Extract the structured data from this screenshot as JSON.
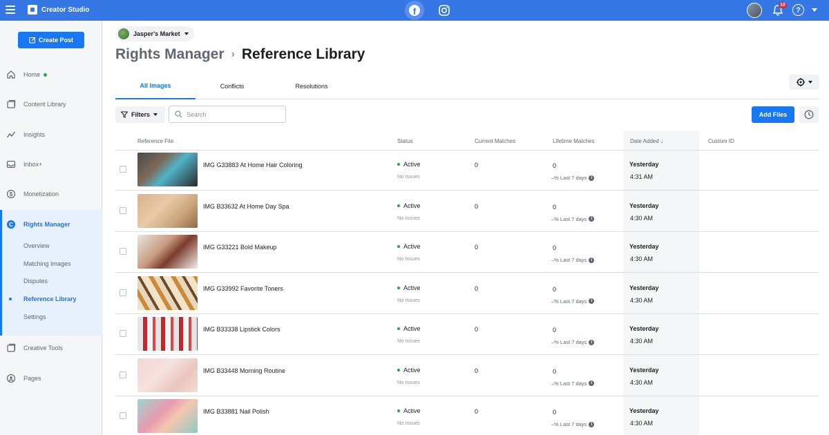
{
  "app": {
    "name": "Creator Studio"
  },
  "topbar": {
    "notification_count": "10",
    "help_label": "?"
  },
  "sidebar": {
    "create_label": "Create Post",
    "items": [
      {
        "label": "Home",
        "icon": "home-icon"
      },
      {
        "label": "Content Library",
        "icon": "library-icon"
      },
      {
        "label": "Insights",
        "icon": "insights-icon"
      },
      {
        "label": "Inbox+",
        "icon": "inbox-icon"
      },
      {
        "label": "Monetization",
        "icon": "dollar-icon"
      },
      {
        "label": "Rights Manager",
        "icon": "rights-manager-icon"
      },
      {
        "label": "Creative Tools",
        "icon": "creative-tools-icon"
      },
      {
        "label": "Pages",
        "icon": "pages-icon"
      }
    ],
    "rights_sub": [
      "Overview",
      "Matching Images",
      "Disputes",
      "Reference Library",
      "Settings"
    ]
  },
  "page": {
    "name": "Jasper's Market",
    "breadcrumb_parent": "Rights Manager",
    "breadcrumb_current": "Reference Library"
  },
  "tabs": [
    {
      "label": "All Images",
      "active": true
    },
    {
      "label": "Conflicts",
      "active": false
    },
    {
      "label": "Resolutions",
      "active": false
    }
  ],
  "toolbar": {
    "filters_label": "Filters",
    "search_placeholder": "Search",
    "add_files_label": "Add Files"
  },
  "table": {
    "columns": [
      "Reference File",
      "Status",
      "Current Matches",
      "Lifetime Matches",
      "Date Added",
      "Custom ID"
    ],
    "sort_indicator": "↓",
    "rows": [
      {
        "file": "IMG G33883 At Home Hair Coloring",
        "status": "Active",
        "issues": "No issues",
        "current": "0",
        "lifetime": "0",
        "trend": "–% Last 7 days",
        "date": "Yesterday",
        "time": "4:31 AM"
      },
      {
        "file": "IMG B33632 At Home Day Spa",
        "status": "Active",
        "issues": "No issues",
        "current": "0",
        "lifetime": "0",
        "trend": "–% Last 7 days",
        "date": "Yesterday",
        "time": "4:30 AM"
      },
      {
        "file": "IMG G33221 Bold Makeup",
        "status": "Active",
        "issues": "No issues",
        "current": "0",
        "lifetime": "0",
        "trend": "–% Last 7 days",
        "date": "Yesterday",
        "time": "4:30 AM"
      },
      {
        "file": "IMG G33992 Favorite Toners",
        "status": "Active",
        "issues": "No issues",
        "current": "0",
        "lifetime": "0",
        "trend": "–% Last 7 days",
        "date": "Yesterday",
        "time": "4:30 AM"
      },
      {
        "file": "IMG B33338 Lipstick Colors",
        "status": "Active",
        "issues": "No issues",
        "current": "0",
        "lifetime": "0",
        "trend": "–% Last 7 days",
        "date": "Yesterday",
        "time": "4:30 AM"
      },
      {
        "file": "IMG B33448 Morning Routine",
        "status": "Active",
        "issues": "No issues",
        "current": "0",
        "lifetime": "0",
        "trend": "–% Last 7 days",
        "date": "Yesterday",
        "time": "4:30 AM"
      },
      {
        "file": "IMG B33881 Nail Polish",
        "status": "Active",
        "issues": "No issues",
        "current": "0",
        "lifetime": "0",
        "trend": "–% Last 7 days",
        "date": "Yesterday",
        "time": "4:30 AM"
      }
    ]
  },
  "colors": {
    "brand": "#3578e5",
    "accent": "#1877f2",
    "active_status": "#31a24c"
  }
}
